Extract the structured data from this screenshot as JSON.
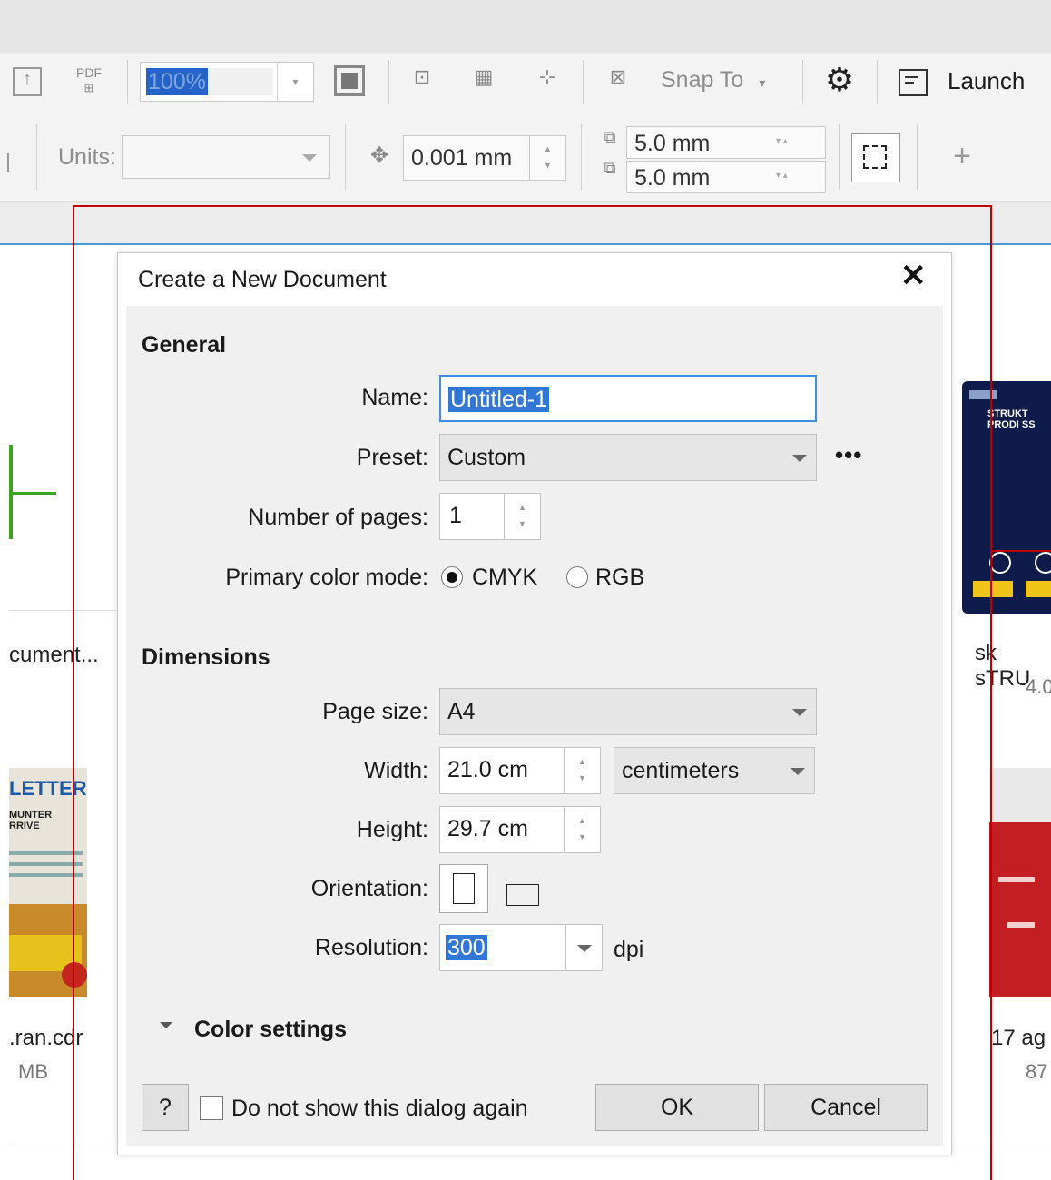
{
  "toolbar1": {
    "pdf_label": "PDF",
    "zoom_value": "100%",
    "snap_to": "Snap To",
    "launch": "Launch"
  },
  "toolbar2": {
    "units_label": "Units:",
    "nudge_value": "0.001 mm",
    "dup_x": "5.0 mm",
    "dup_y": "5.0 mm"
  },
  "background": {
    "left_caption_1": "cument...",
    "left_caption_2": ".ran.cdr",
    "left_size_2": "MB",
    "left_thumb_title": "LETTER",
    "left_thumb_sub": "MUNTER\nRRIVE",
    "right_caption_1": "sk sTRU",
    "right_size_1": "4.0",
    "right_caption_2": "17 ag",
    "right_size_2": "87",
    "right_thumb_text": "STRUKT\nPRODI SS"
  },
  "dialog": {
    "title": "Create a New Document",
    "general_heading": "General",
    "name_label": "Name:",
    "name_value": "Untitled-1",
    "preset_label": "Preset:",
    "preset_value": "Custom",
    "pages_label": "Number of pages:",
    "pages_value": "1",
    "color_mode_label": "Primary color mode:",
    "cmyk": "CMYK",
    "rgb": "RGB",
    "dimensions_heading": "Dimensions",
    "page_size_label": "Page size:",
    "page_size_value": "A4",
    "width_label": "Width:",
    "width_value": "21.0 cm",
    "units_value": "centimeters",
    "height_label": "Height:",
    "height_value": "29.7 cm",
    "orientation_label": "Orientation:",
    "resolution_label": "Resolution:",
    "resolution_value": "300",
    "resolution_unit": "dpi",
    "color_settings": "Color settings",
    "help": "?",
    "dont_show": "Do not show this dialog again",
    "ok": "OK",
    "cancel": "Cancel"
  }
}
